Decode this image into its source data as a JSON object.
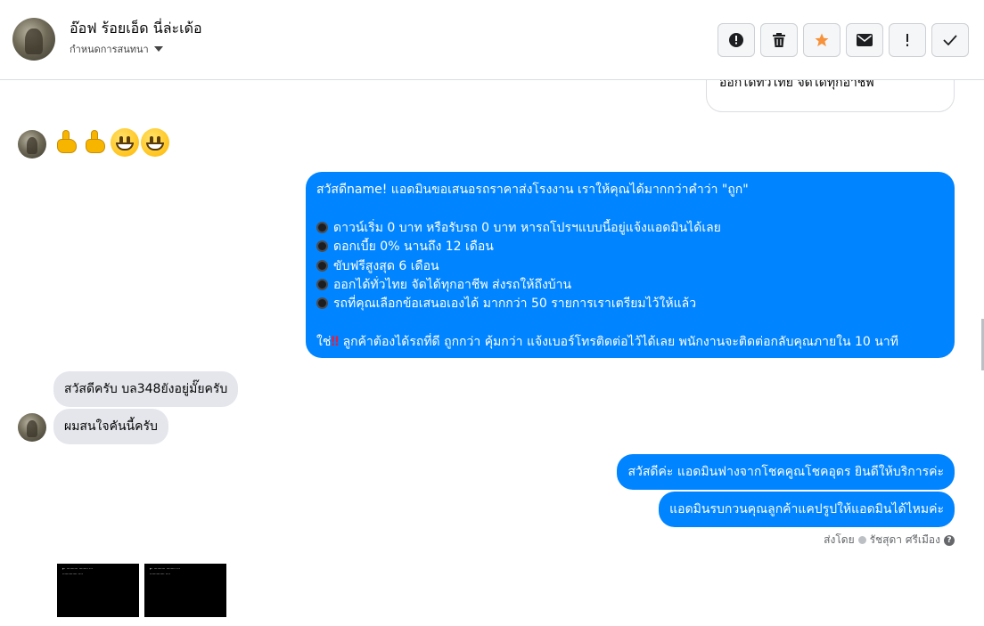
{
  "header": {
    "name": "อ๊อฟ ร้อยเอ็ด นี่ล่ะเด้อ",
    "sub_label": "กำหนดการสนทนา"
  },
  "actions": [
    {
      "name": "report-button",
      "icon": "alert-circle-icon",
      "symbol": "!"
    },
    {
      "name": "delete-button",
      "icon": "trash-icon"
    },
    {
      "name": "star-button",
      "icon": "star-icon",
      "color": "#f7923a"
    },
    {
      "name": "mark-unread-button",
      "icon": "envelope-icon"
    },
    {
      "name": "flag-button",
      "icon": "exclamation-icon",
      "symbol": "!"
    },
    {
      "name": "done-button",
      "icon": "check-icon"
    }
  ],
  "messages": {
    "prev_out_tail": "ออกได้ทั่วไทย จัดได้ทุกอาชีพ",
    "emoji_in": [
      "thumbs-up",
      "thumbs-up",
      "grinning-face",
      "grinning-face"
    ],
    "promo": {
      "greeting": "สวัสดีname! แอดมินขอเสนอรถราคาส่งโรงงาน เราให้คุณได้มากกว่าคำว่า \"ถูก\"",
      "bullets": [
        "ดาวน์เริ่ม 0 บาท หรือรับรถ 0 บาท หารถโปรฯแบบนี้อยู่แจ้งแอดมินได้เลย",
        "ดอกเบี้ย 0% นานถึง 12 เดือน",
        "ขับฟรีสูงสุด 6 เดือน",
        "ออกได้ทั่วไทย จัดได้ทุกอาชีพ ส่งรถให้ถึงบ้าน",
        "รถที่คุณเลือกข้อเสนอเองได้ มากกว่า 50 รายการเราเตรียมไว้ให้แล้ว"
      ],
      "closing_prefix": "ใช่",
      "closing_bang": "‼",
      "closing_rest": "ลูกค้าต้องได้รถที่ดี ถูกกว่า คุ้มกว่า แจ้งเบอร์โทรติดต่อไว้ได้เลย พนักงานจะติดต่อกลับคุณภายใน 10 นาที"
    },
    "in_1": "สวัสดีครับ บล348ยังอยู่มั๊ยครับ",
    "in_2": "ผมสนใจคันนี้ครับ",
    "out_1": "สวัสดีค่ะ แอดมินฟางจากโชคคูณโชคอุดร ยินดีให้บริการค่ะ",
    "out_2": "แอดมินรบกวนคุณลูกค้าแคปรูปให้แอดมินได้ไหมค่ะ",
    "sent_by_label": "ส่งโดย",
    "sent_by_name": "รัชสุดา ศรีเมือง"
  },
  "colors": {
    "outgoing_bubble": "#0084ff",
    "incoming_bubble": "#e4e6eb"
  }
}
